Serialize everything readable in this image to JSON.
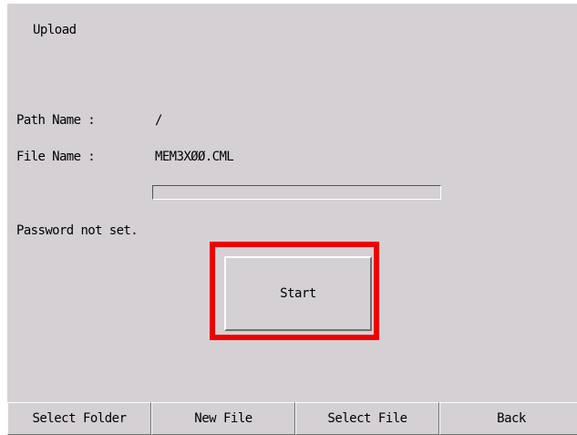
{
  "window": {
    "title": "Upload"
  },
  "fields": {
    "path_label": "Path Name :",
    "path_value": "/",
    "file_label": "File Name :",
    "file_value": "MEM3XØØ.CML"
  },
  "progress": {
    "fraction": 0
  },
  "status": {
    "password_message": "Password not set."
  },
  "actions": {
    "start_label": "Start"
  },
  "bottom_bar": {
    "buttons": [
      {
        "label": "Select Folder"
      },
      {
        "label": "New File"
      },
      {
        "label": "Select File"
      },
      {
        "label": "Back"
      }
    ]
  },
  "colors": {
    "panel_background": "#d4d0d4",
    "highlight": "#ee0000"
  }
}
